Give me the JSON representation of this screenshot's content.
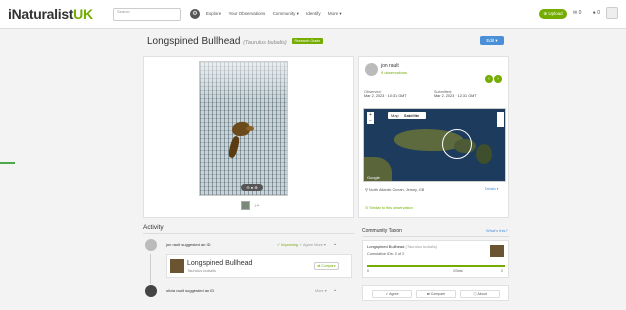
{
  "topbar": {
    "logo_i": "iNaturalist",
    "logo_uk": "UK",
    "search_placeholder": "Search",
    "nav": [
      "Explore",
      "Your Observations",
      "Community ▾",
      "Identify",
      "More ▾"
    ],
    "upload_label": "Upload",
    "messages_count": "0",
    "notifications_count": "0"
  },
  "observation": {
    "common_name": "Longspined Bullhead",
    "sci_name": "(Taurulus bubalis)",
    "grade_badge": "Research Grade",
    "edit_label": "Edit ▾"
  },
  "observer": {
    "name": "jon rault",
    "obs_count": "9 observations",
    "observed_label": "Observed:",
    "observed_date": "Mar 2, 2023 · 10:31 GMT",
    "submitted_label": "Submitted:",
    "submitted_date": "Mar 2, 2023 · 12:31 GMT",
    "location": "North Atlantic Ocean, Jersey, GB",
    "details_link": "Details ▾",
    "taxon_link": "Similar to this observation"
  },
  "map": {
    "tab_map": "Map",
    "tab_satellite": "Satellite",
    "attribution": "Google"
  },
  "activity": {
    "heading": "Activity",
    "comment1_text": "jon rault suggested an ID",
    "comment1_status": "✓ Improving",
    "comment1_agree": "✓ Agree",
    "comment1_more": "More ▾",
    "id_common": "Longspined Bullhead",
    "id_sci": "Taurulus bubalis",
    "compare_label": "⇄ Compare",
    "comment2_text": "olivia rault suggested an ID",
    "comment2_more": "More ▾"
  },
  "community_taxon": {
    "heading": "Community Taxon",
    "whats_this": "What's this?",
    "name": "Longspined Bullhead",
    "sci": "(Taurulus bubalis)",
    "cumulative": "Cumulative IDs: 2 of 2",
    "scale_min": "0",
    "scale_mid": "2/3rds",
    "scale_max": "2",
    "btn_agree": "✓ Agree",
    "btn_compare": "⇄ Compare",
    "btn_about": "ⓘ About"
  },
  "colors": {
    "brand_green": "#74ac00",
    "link_blue": "#4a90d9"
  }
}
